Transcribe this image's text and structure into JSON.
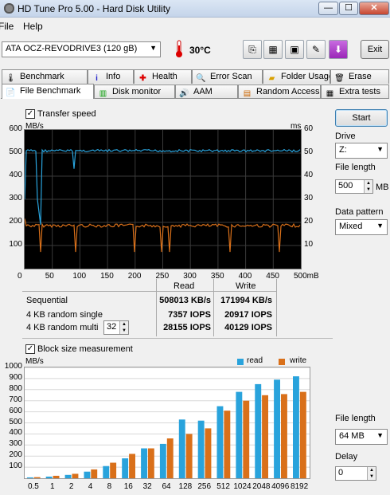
{
  "window": {
    "title": "HD Tune Pro 5.00 - Hard Disk Utility",
    "minimize": "—",
    "maximize": "☐",
    "close": "✕"
  },
  "menu": {
    "file": "File",
    "help": "Help"
  },
  "toolbar": {
    "drive": "ATA    OCZ-REVODRIVE3   (120 gB)",
    "temperature": "30°C",
    "exit": "Exit"
  },
  "tabs_top": [
    "Benchmark",
    "Info",
    "Health",
    "Error Scan",
    "Folder Usage",
    "Erase"
  ],
  "tabs_bottom": [
    "File Benchmark",
    "Disk monitor",
    "AAM",
    "Random Access",
    "Extra tests"
  ],
  "transfer": {
    "checkbox_label": "Transfer speed",
    "left_unit": "MB/s",
    "right_unit": "ms",
    "left_ticks": [
      "600",
      "500",
      "400",
      "300",
      "200",
      "100"
    ],
    "right_ticks": [
      "60",
      "50",
      "40",
      "30",
      "20",
      "10"
    ],
    "x_ticks": [
      "0",
      "50",
      "100",
      "150",
      "200",
      "250",
      "300",
      "350",
      "400",
      "450",
      "500mB"
    ]
  },
  "results": {
    "col_read": "Read",
    "col_write": "Write",
    "rows": [
      {
        "label": "Sequential",
        "read": "508013 KB/s",
        "write": "171994 KB/s"
      },
      {
        "label": "4 KB random single",
        "read": "7357 IOPS",
        "write": "20917 IOPS"
      },
      {
        "label": "4 KB random multi",
        "read": "28155 IOPS",
        "write": "40129 IOPS"
      }
    ],
    "multi_queue": "32"
  },
  "right_panel": {
    "start": "Start",
    "drive_label": "Drive",
    "drive_value": "Z:",
    "file_length_label": "File length",
    "file_length_value": "500",
    "file_length_unit": "MB",
    "pattern_label": "Data pattern",
    "pattern_value": "Mixed",
    "file_length2_label": "File length",
    "file_length2_value": "64 MB",
    "delay_label": "Delay",
    "delay_value": "0"
  },
  "colors": {
    "read": "#29a3dc",
    "write": "#d9701a",
    "grid": "#3a3a3a"
  },
  "block_chart": {
    "checkbox_label": "Block size measurement",
    "chart_data": {
      "type": "bar",
      "ylabel": "MB/s",
      "ylim": [
        0,
        1000
      ],
      "yticks": [
        "1000",
        "900",
        "800",
        "700",
        "600",
        "500",
        "400",
        "300",
        "200",
        "100"
      ],
      "categories": [
        "0.5",
        "1",
        "2",
        "4",
        "8",
        "16",
        "32",
        "64",
        "128",
        "256",
        "512",
        "1024",
        "2048",
        "4096",
        "8192"
      ],
      "series": [
        {
          "name": "read",
          "values": [
            8,
            15,
            30,
            60,
            110,
            180,
            270,
            310,
            530,
            520,
            650,
            780,
            850,
            890,
            920
          ]
        },
        {
          "name": "write",
          "values": [
            10,
            22,
            40,
            80,
            140,
            220,
            270,
            360,
            400,
            450,
            610,
            700,
            750,
            760,
            780
          ]
        }
      ]
    }
  }
}
